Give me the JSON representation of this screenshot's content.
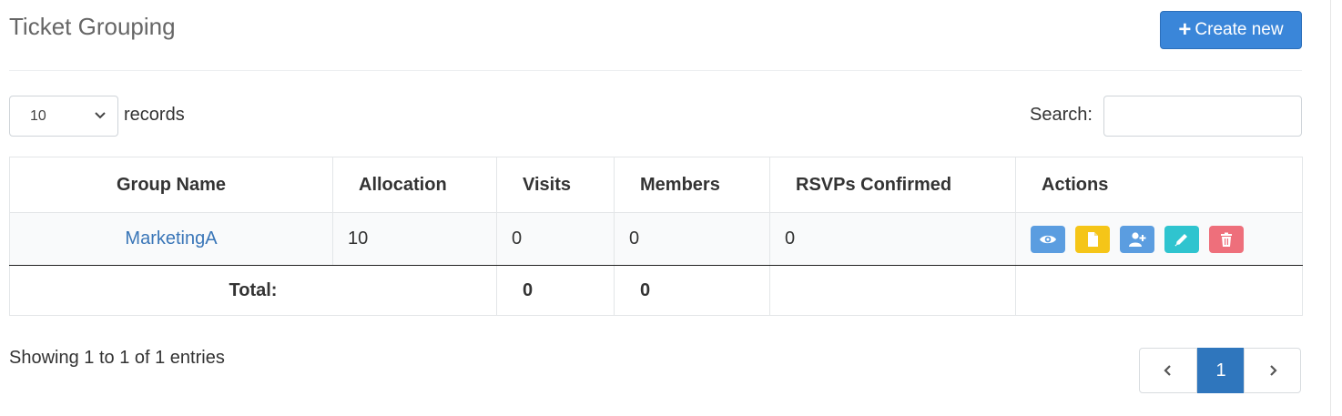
{
  "page": {
    "title": "Ticket Grouping"
  },
  "toolbar": {
    "create_label": "Create new",
    "create_icon": "plus-icon"
  },
  "length_menu": {
    "selected": "10",
    "label": "records"
  },
  "search": {
    "label": "Search:",
    "value": ""
  },
  "table": {
    "headers": [
      "Group Name",
      "Allocation",
      "Visits",
      "Members",
      "RSVPs Confirmed",
      "Actions"
    ],
    "rows": [
      {
        "group_name": "MarketingA",
        "allocation": "10",
        "visits": "0",
        "members": "0",
        "rsvps_confirmed": "0"
      }
    ],
    "footer": {
      "label": "Total:",
      "visits": "0",
      "members": "0"
    },
    "actions": [
      {
        "icon": "eye-icon",
        "color": "#5b9de0"
      },
      {
        "icon": "file-icon",
        "color": "#f5c518"
      },
      {
        "icon": "user-plus-icon",
        "color": "#5b9de0"
      },
      {
        "icon": "pencil-icon",
        "color": "#2fc4cf"
      },
      {
        "icon": "trash-icon",
        "color": "#ee6f7b"
      }
    ]
  },
  "info": {
    "text": "Showing 1 to 1 of 1 entries"
  },
  "pagination": {
    "current": "1",
    "prev_icon": "chevron-left-icon",
    "next_icon": "chevron-right-icon"
  }
}
